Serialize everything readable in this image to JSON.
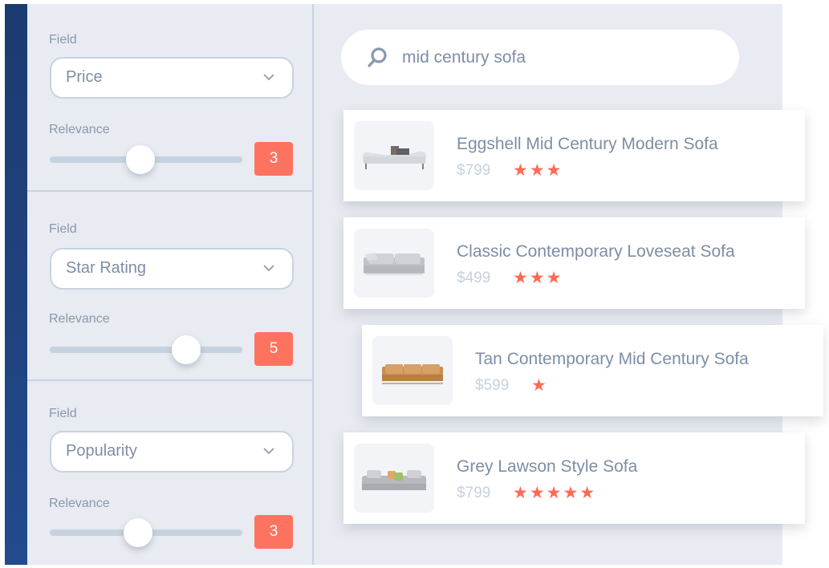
{
  "colors": {
    "accent_bar": "#1b3a70",
    "panel_bg": "#e8ebf1",
    "badge": "#fe7260",
    "star": "#fe6a56",
    "text_muted": "#7d8ea6",
    "price": "#c6d1e0"
  },
  "filters": [
    {
      "field_label": "Field",
      "field_value": "Price",
      "relevance_label": "Relevance",
      "relevance_value": "3",
      "slider_fraction": 0.47
    },
    {
      "field_label": "Field",
      "field_value": "Star Rating",
      "relevance_label": "Relevance",
      "relevance_value": "5",
      "slider_fraction": 0.71
    },
    {
      "field_label": "Field",
      "field_value": "Popularity",
      "relevance_label": "Relevance",
      "relevance_value": "3",
      "slider_fraction": 0.46
    }
  ],
  "search": {
    "icon": "search-icon",
    "query": "mid century sofa"
  },
  "results": [
    {
      "title": "Eggshell Mid Century Modern Sofa",
      "price": "$799",
      "stars": 3,
      "stars_text": "★★★",
      "thumb": "white-sofa"
    },
    {
      "title": "Classic Contemporary Loveseat Sofa",
      "price": "$499",
      "stars": 3,
      "stars_text": "★★★",
      "thumb": "grey-loveseat"
    },
    {
      "title": "Tan Contemporary Mid Century Sofa",
      "price": "$599",
      "stars": 1,
      "stars_text": "★",
      "thumb": "tan-sofa"
    },
    {
      "title": "Grey Lawson Style Sofa",
      "price": "$799",
      "stars": 5,
      "stars_text": "★★★★★",
      "thumb": "grey-lawson-sofa"
    }
  ]
}
